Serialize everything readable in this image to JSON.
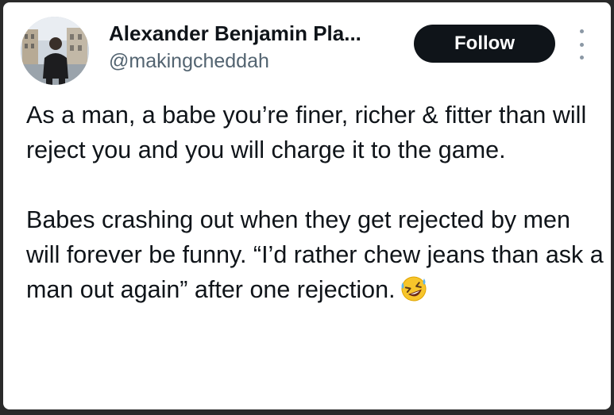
{
  "tweet": {
    "author_name": "Alexander Benjamin Pla...",
    "author_handle": "@makingcheddah",
    "follow_label": "Follow",
    "paragraphs": [
      "As a man, a babe you’re finer, richer & fitter than will reject you and you will charge it to the game.",
      "Babes crashing out when they get rejected by men will forever be funny. “I’d rather chew jeans than ask a man out again” after one rejection."
    ],
    "emoji": "rolling-on-the-floor-laughing-emoji"
  },
  "colors": {
    "text": "#0f1419",
    "secondary_text": "#536471",
    "button_bg": "#0f1419",
    "button_text": "#ffffff",
    "card_bg": "#ffffff"
  }
}
